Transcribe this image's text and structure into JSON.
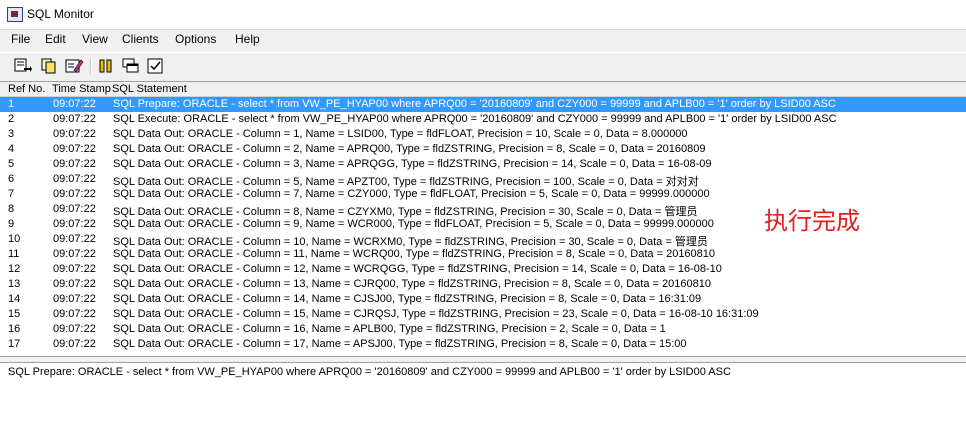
{
  "window": {
    "title": "SQL Monitor"
  },
  "menu": [
    "File",
    "Edit",
    "View",
    "Clients",
    "Options",
    "Help"
  ],
  "toolbar": {
    "buttons": [
      "save-log-icon",
      "copy-icon",
      "edit-icon",
      "pause-icon",
      "clients-icon",
      "options-icon"
    ]
  },
  "list": {
    "columns": [
      "Ref No.",
      "Time Stamp",
      "SQL Statement"
    ],
    "rows": [
      {
        "ref": "1",
        "time": "09:07:22",
        "sql": "SQL Prepare: ORACLE - select * from VW_PE_HYAP00 where APRQ00 = '20160809' and CZY000 = 99999 and APLB00 = '1'  order by LSID00 ASC"
      },
      {
        "ref": "2",
        "time": "09:07:22",
        "sql": "SQL Execute: ORACLE - select * from VW_PE_HYAP00 where APRQ00 = '20160809' and CZY000 = 99999 and APLB00 = '1'  order by LSID00 ASC"
      },
      {
        "ref": "3",
        "time": "09:07:22",
        "sql": "SQL Data Out: ORACLE - Column = 1, Name = LSID00, Type = fldFLOAT, Precision = 10, Scale = 0, Data = 8.000000"
      },
      {
        "ref": "4",
        "time": "09:07:22",
        "sql": "SQL Data Out: ORACLE - Column = 2, Name = APRQ00, Type = fldZSTRING, Precision = 8, Scale = 0, Data = 20160809"
      },
      {
        "ref": "5",
        "time": "09:07:22",
        "sql": "SQL Data Out: ORACLE - Column = 3, Name = APRQGG, Type = fldZSTRING, Precision = 14, Scale = 0, Data = 16-08-09"
      },
      {
        "ref": "6",
        "time": "09:07:22",
        "sql": "SQL Data Out: ORACLE - Column = 5, Name = APZT00, Type = fldZSTRING, Precision = 100, Scale = 0, Data = 对对对"
      },
      {
        "ref": "7",
        "time": "09:07:22",
        "sql": "SQL Data Out: ORACLE - Column = 7, Name = CZY000, Type = fldFLOAT, Precision = 5, Scale = 0, Data = 99999.000000"
      },
      {
        "ref": "8",
        "time": "09:07:22",
        "sql": "SQL Data Out: ORACLE - Column = 8, Name = CZYXM0, Type = fldZSTRING, Precision = 30, Scale = 0, Data = 管理员"
      },
      {
        "ref": "9",
        "time": "09:07:22",
        "sql": "SQL Data Out: ORACLE - Column = 9, Name = WCR000, Type = fldFLOAT, Precision = 5, Scale = 0, Data = 99999.000000"
      },
      {
        "ref": "10",
        "time": "09:07:22",
        "sql": "SQL Data Out: ORACLE - Column = 10, Name = WCRXM0, Type = fldZSTRING, Precision = 30, Scale = 0, Data = 管理员"
      },
      {
        "ref": "11",
        "time": "09:07:22",
        "sql": "SQL Data Out: ORACLE - Column = 11, Name = WCRQ00, Type = fldZSTRING, Precision = 8, Scale = 0, Data = 20160810"
      },
      {
        "ref": "12",
        "time": "09:07:22",
        "sql": "SQL Data Out: ORACLE - Column = 12, Name = WCRQGG, Type = fldZSTRING, Precision = 14, Scale = 0, Data = 16-08-10"
      },
      {
        "ref": "13",
        "time": "09:07:22",
        "sql": "SQL Data Out: ORACLE - Column = 13, Name = CJRQ00, Type = fldZSTRING, Precision = 8, Scale = 0, Data = 20160810"
      },
      {
        "ref": "14",
        "time": "09:07:22",
        "sql": "SQL Data Out: ORACLE - Column = 14, Name = CJSJ00, Type = fldZSTRING, Precision = 8, Scale = 0, Data = 16:31:09"
      },
      {
        "ref": "15",
        "time": "09:07:22",
        "sql": "SQL Data Out: ORACLE - Column = 15, Name = CJRQSJ, Type = fldZSTRING, Precision = 23, Scale = 0, Data = 16-08-10 16:31:09"
      },
      {
        "ref": "16",
        "time": "09:07:22",
        "sql": "SQL Data Out: ORACLE - Column = 16, Name = APLB00, Type = fldZSTRING, Precision = 2, Scale = 0, Data = 1"
      },
      {
        "ref": "17",
        "time": "09:07:22",
        "sql": "SQL Data Out: ORACLE - Column = 17, Name = APSJ00, Type = fldZSTRING, Precision = 8, Scale = 0, Data = 15:00"
      }
    ],
    "selected_index": 0
  },
  "detail": {
    "text": "SQL Prepare: ORACLE - select * from VW_PE_HYAP00 where APRQ00 = '20160809' and CZY000 = 99999 and APLB00 = '1'  order by LSID00 ASC"
  },
  "annotation": {
    "text": "执行完成",
    "color": "#e02020"
  },
  "colors": {
    "selection": "#3399ff",
    "background": "#f0f0f0"
  }
}
